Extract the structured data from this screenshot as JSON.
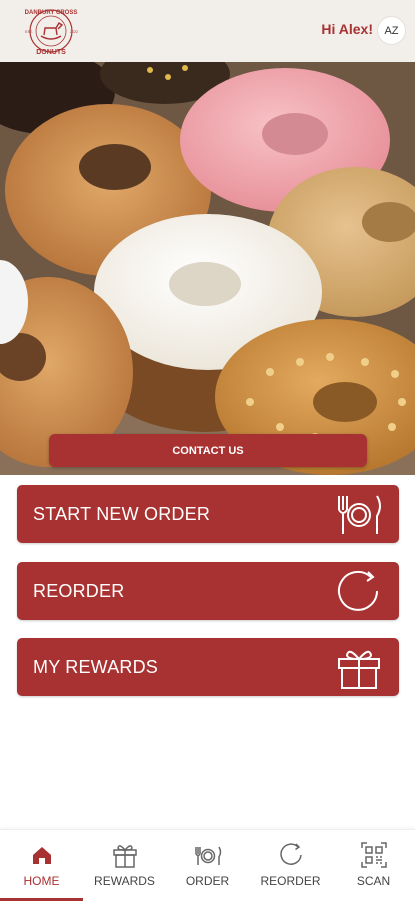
{
  "header": {
    "logo": {
      "top_text": "DANBURY CROSS",
      "est": "EST.",
      "year": "2022",
      "bottom_text": "DONUTS"
    },
    "greeting": "Hi Alex!",
    "avatar_initials": "AZ"
  },
  "hero": {
    "contact_label": "CONTACT US"
  },
  "actions": [
    {
      "label": "START NEW ORDER",
      "icon": "fork-plate-knife-icon"
    },
    {
      "label": "REORDER",
      "icon": "refresh-icon"
    },
    {
      "label": "MY REWARDS",
      "icon": "gift-icon"
    }
  ],
  "tabbar": {
    "active": "HOME",
    "tabs": [
      {
        "label": "HOME",
        "icon": "home-icon"
      },
      {
        "label": "REWARDS",
        "icon": "gift-icon"
      },
      {
        "label": "ORDER",
        "icon": "fork-plate-knife-icon"
      },
      {
        "label": "REORDER",
        "icon": "refresh-icon"
      },
      {
        "label": "SCAN",
        "icon": "qr-scan-icon"
      }
    ]
  },
  "colors": {
    "brand": "#a83232",
    "header_bg": "#f2eeea",
    "tab_text": "#444444"
  }
}
